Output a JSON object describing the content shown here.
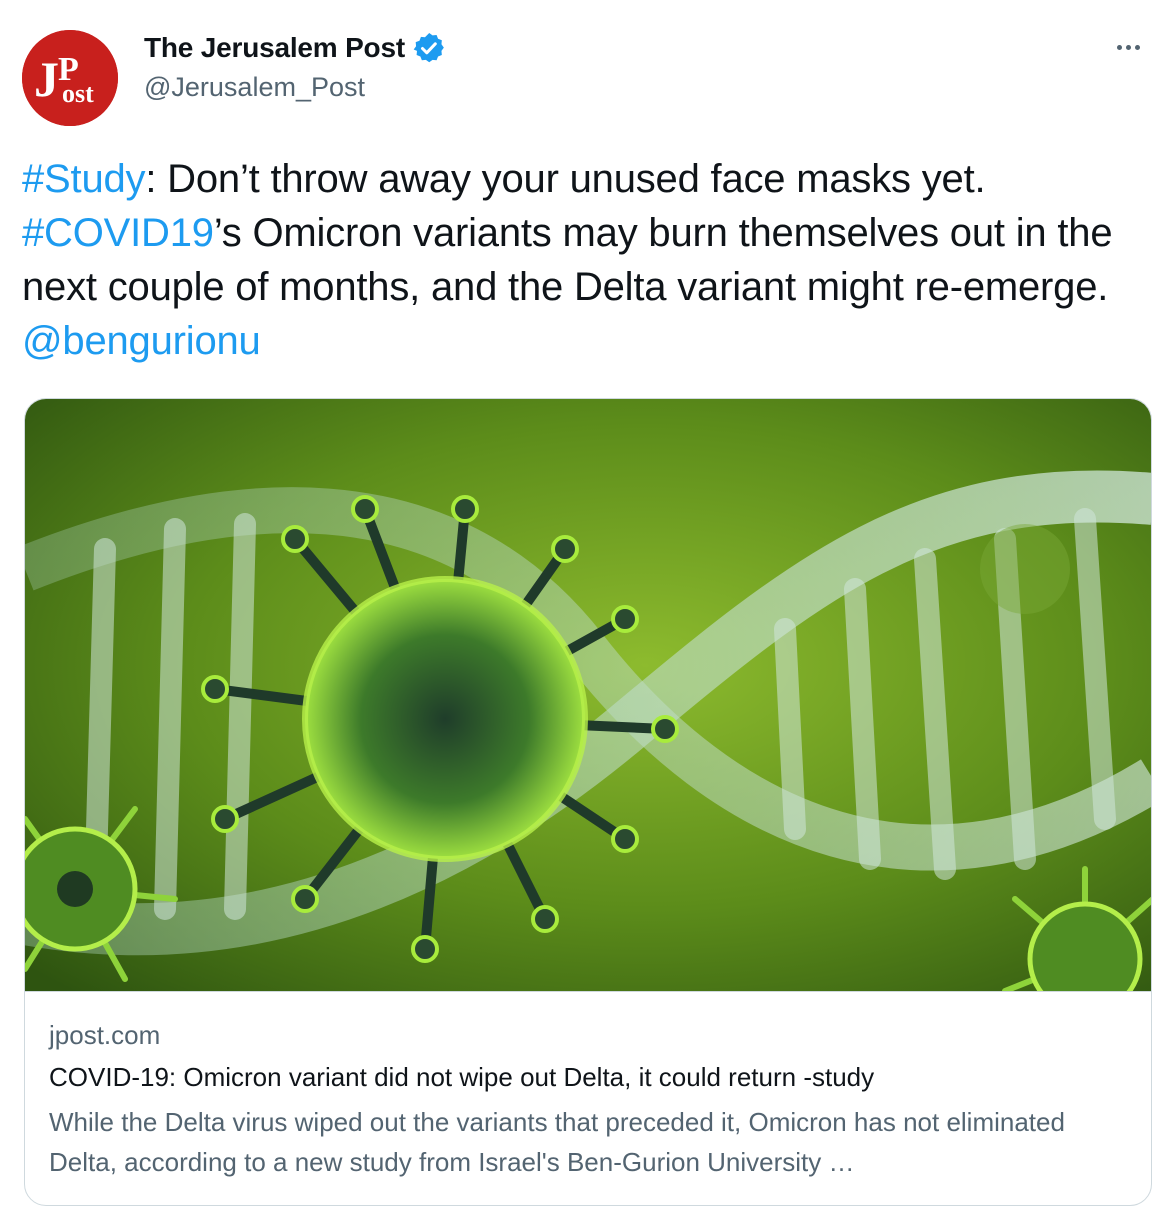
{
  "tweet": {
    "author": {
      "display_name": "The Jerusalem Post",
      "handle": "@Jerusalem_Post",
      "avatar_logo_text": "JPost",
      "verified": true
    },
    "more_icon": "more-dots-icon",
    "text": {
      "hashtag_study": "#Study",
      "part1": ": Don’t throw away your unused face masks yet. ",
      "hashtag_covid": "#COVID19",
      "part2": "’s Omicron variants may burn themselves out in the next couple of months, and the Delta variant might re-emerge. ",
      "mention": "@bengurionu"
    },
    "card": {
      "domain": "jpost.com",
      "title": "COVID-19: Omicron variant did not wipe out Delta, it could return -study",
      "description": "While the Delta virus wiped out the variants that preceded it, Omicron has not eliminated Delta, according to a new study from Israel's Ben-Gurion University …"
    }
  },
  "colors": {
    "link": "#1d9bf0",
    "text": "#0f1419",
    "secondary": "#536471",
    "border": "#cfd9de",
    "brand_red": "#c8201d",
    "image_green": "#6a9a1c"
  }
}
